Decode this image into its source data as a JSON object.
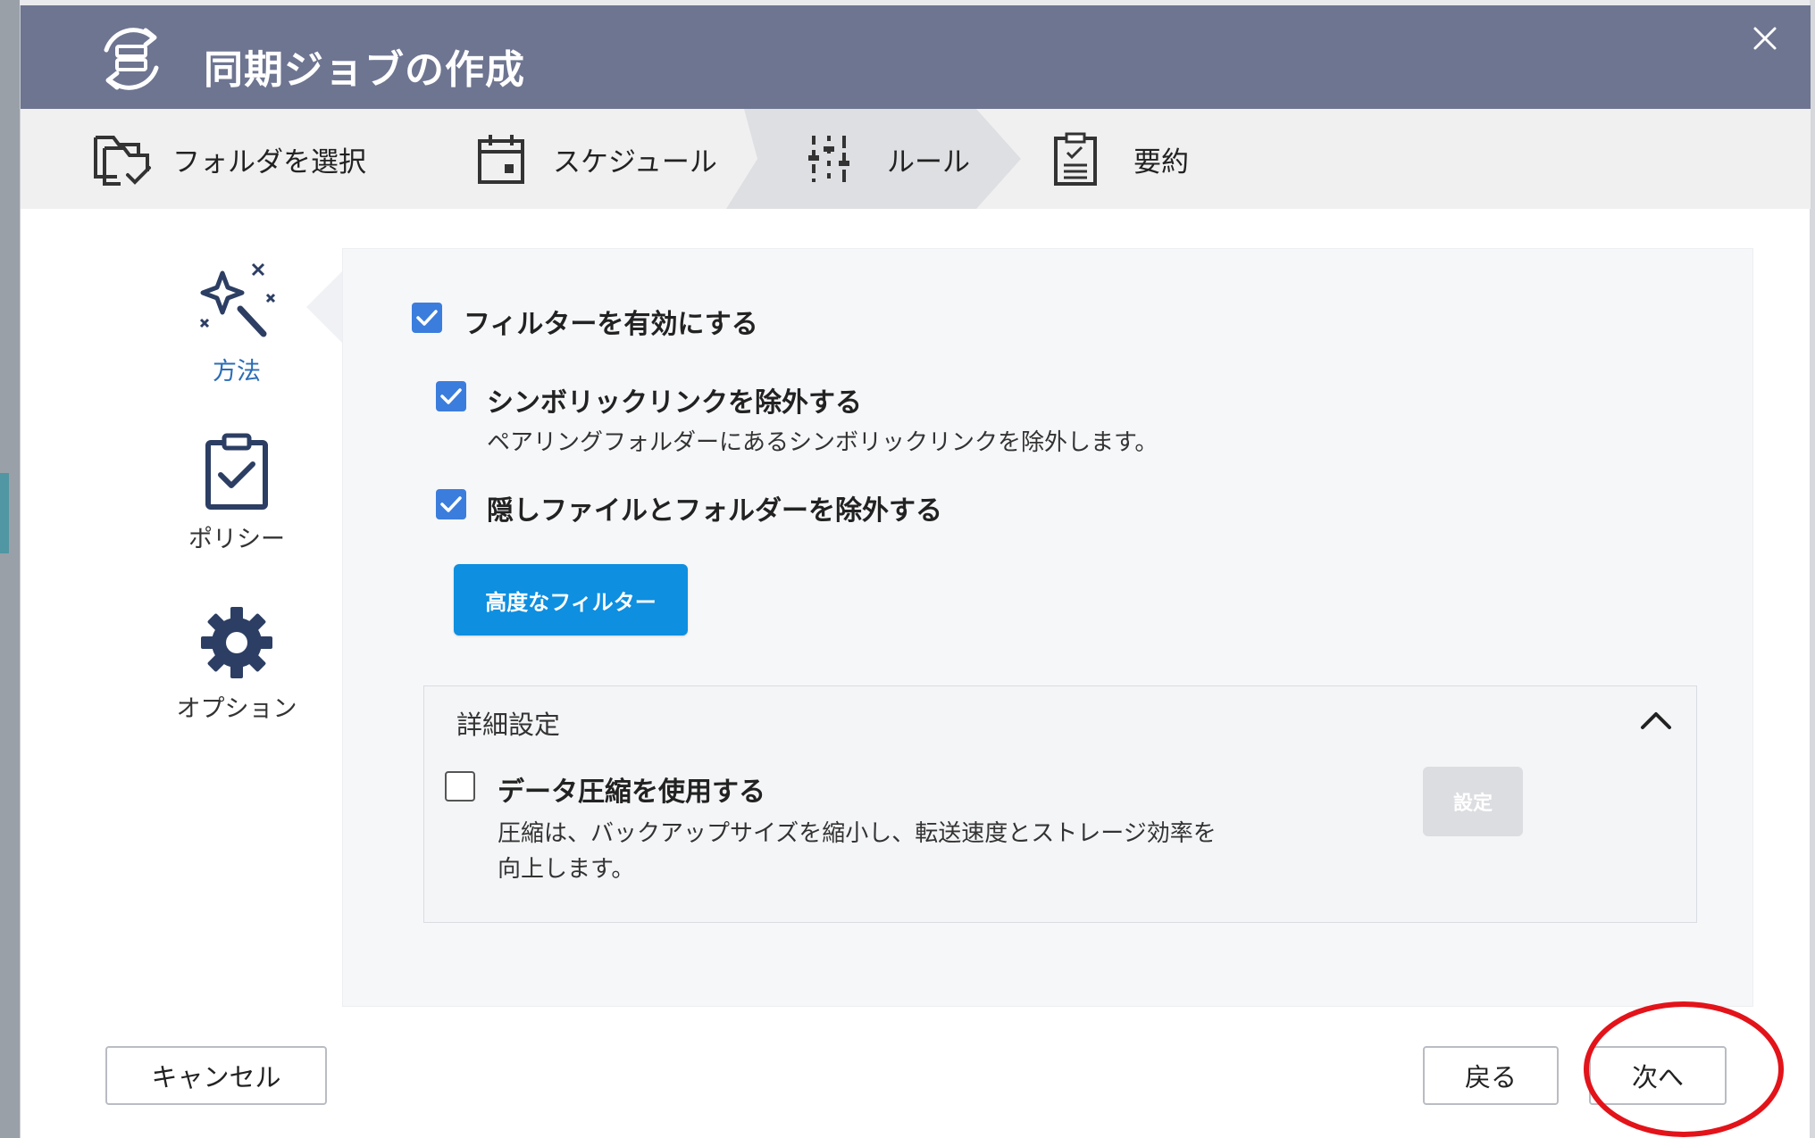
{
  "dialog": {
    "title": "同期ジョブの作成"
  },
  "steps": [
    {
      "label": "フォルダを選択",
      "icon": "folder-check-icon"
    },
    {
      "label": "スケジュール",
      "icon": "calendar-icon"
    },
    {
      "label": "ルール",
      "icon": "sliders-icon",
      "active": true
    },
    {
      "label": "要約",
      "icon": "clipboard-list-icon"
    }
  ],
  "nav": [
    {
      "label": "方法",
      "icon": "magic-wand-icon",
      "active": true
    },
    {
      "label": "ポリシー",
      "icon": "clipboard-check-icon"
    },
    {
      "label": "オプション",
      "icon": "gear-icon"
    }
  ],
  "filters": {
    "enable_label": "フィルターを有効にする",
    "enable_checked": true,
    "symlink_label": "シンボリックリンクを除外する",
    "symlink_checked": true,
    "symlink_desc": "ペアリングフォルダーにあるシンボリックリンクを除外します。",
    "hidden_label": "隠しファイルとフォルダーを除外する",
    "hidden_checked": true,
    "advanced_button": "高度なフィルター"
  },
  "advanced": {
    "title": "詳細設定",
    "compression_label": "データ圧縮を使用する",
    "compression_checked": false,
    "compression_desc_line1": "圧縮は、バックアップサイズを縮小し、転送速度とストレージ効率を",
    "compression_desc_line2": "向上します。",
    "settings_button": "設定"
  },
  "footer": {
    "cancel": "キャンセル",
    "back": "戻る",
    "next": "次へ"
  },
  "colors": {
    "titlebar": "#6e7591",
    "accent": "#3b7ddd",
    "primary_button": "#0e8fe0",
    "annotation_ring": "#e3131a"
  }
}
